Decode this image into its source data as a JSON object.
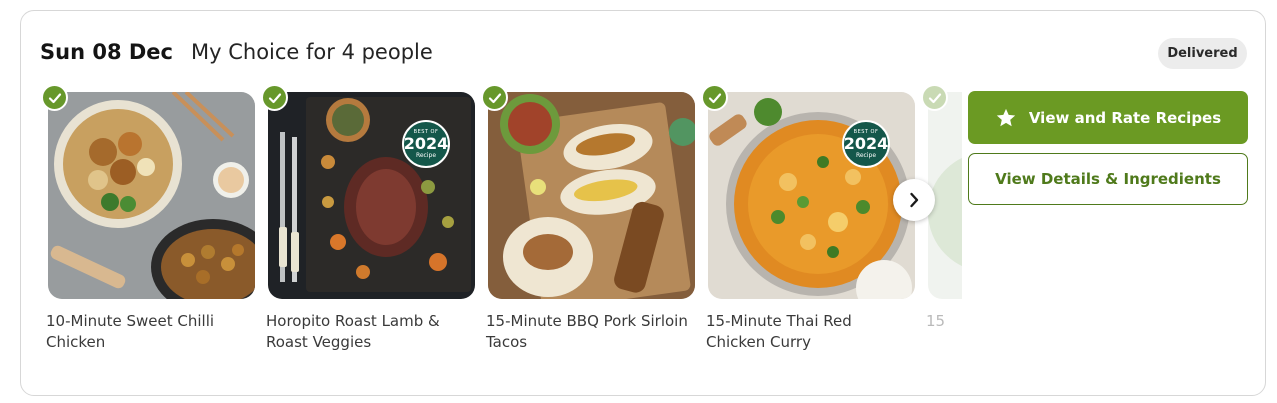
{
  "header": {
    "date": "Sun 08 Dec",
    "plan": "My Choice for 4 people",
    "status": "Delivered"
  },
  "recipes": [
    {
      "name": "10-Minute Sweet Chilli Chicken",
      "selected": true,
      "award": null
    },
    {
      "name": "Horopito Roast Lamb & Roast Veggies",
      "selected": true,
      "award": {
        "top": "BEST OF",
        "year": "2024",
        "sub": "Recipe"
      }
    },
    {
      "name": "15-Minute BBQ Pork Sirloin Tacos",
      "selected": true,
      "award": null
    },
    {
      "name": "15-Minute Thai Red Chicken Curry",
      "selected": true,
      "award": {
        "top": "BEST OF",
        "year": "2024",
        "sub": "Recipe"
      }
    },
    {
      "name": "15",
      "selected": true,
      "award": null
    }
  ],
  "actions": {
    "rate_label": "View and Rate Recipes",
    "details_label": "View Details & Ingredients"
  },
  "icons": {
    "check": "check-icon",
    "star": "star-icon",
    "next": "chevron-right-icon"
  },
  "colors": {
    "brand_green": "#6b9a23",
    "check_green": "#67982b",
    "outline_green": "#4f7a1b",
    "badge_bg": "#ececec",
    "award_teal": "#14574a"
  }
}
